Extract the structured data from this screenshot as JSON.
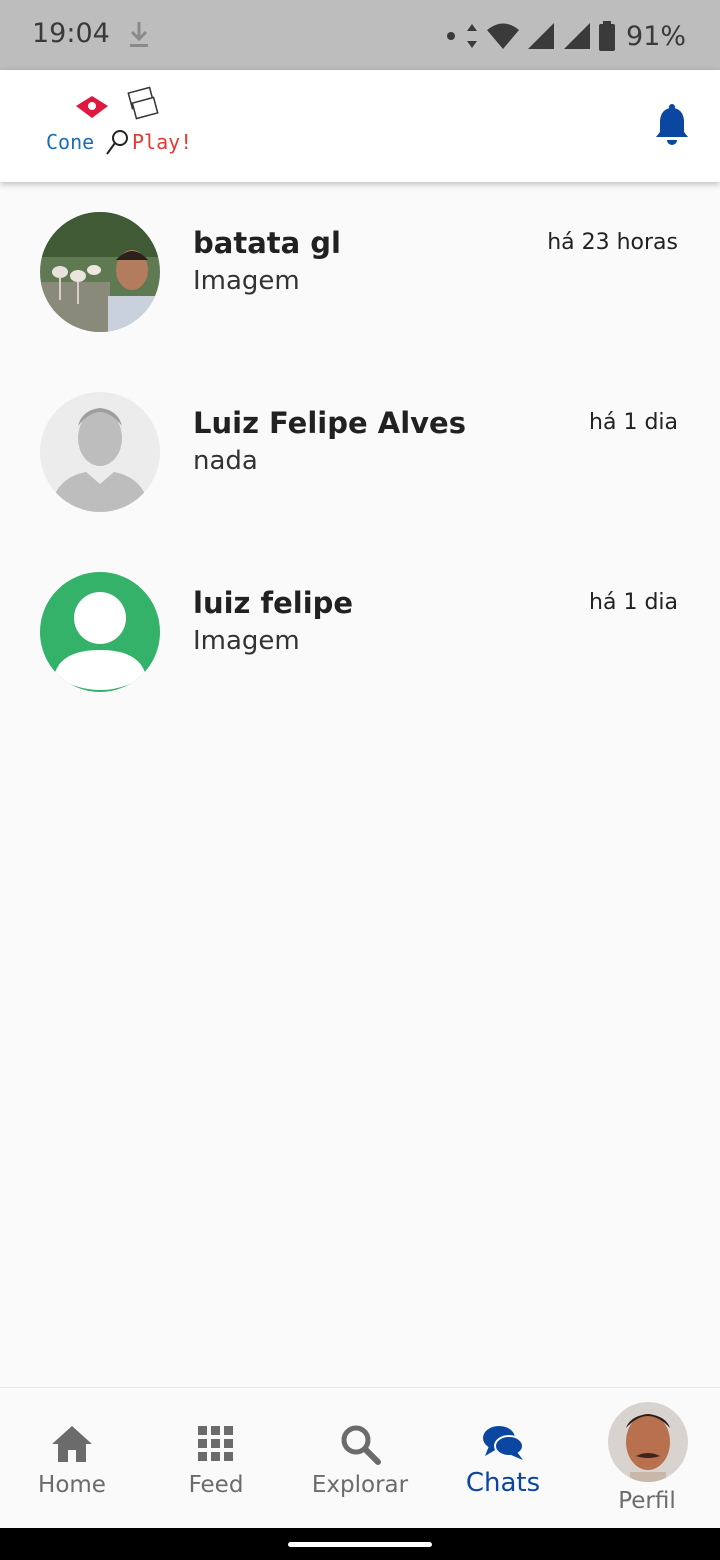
{
  "status_bar": {
    "time": "19:04",
    "battery": "91%",
    "icons": [
      "download-icon",
      "dot-icon",
      "data-arrows-icon",
      "wifi-icon",
      "signal-icon",
      "signal-icon",
      "battery-icon"
    ]
  },
  "header": {
    "logo_left": "Cone",
    "logo_right": "Play!",
    "notification_icon": "bell-icon",
    "accent": "#0b47a1"
  },
  "chats": [
    {
      "name": "batata gl",
      "preview": "Imagem",
      "time": "há 23 horas",
      "avatar": "photo-avatar"
    },
    {
      "name": "Luiz Felipe Alves",
      "preview": "nada",
      "time": "há 1 dia",
      "avatar": "placeholder-gray-avatar"
    },
    {
      "name": "luiz felipe",
      "preview": "Imagem",
      "time": "há 1 dia",
      "avatar": "placeholder-green-avatar"
    }
  ],
  "nav": {
    "items": [
      {
        "label": "Home",
        "icon": "home-icon"
      },
      {
        "label": "Feed",
        "icon": "grid-icon"
      },
      {
        "label": "Explorar",
        "icon": "search-icon"
      },
      {
        "label": "Chats",
        "icon": "chat-icon",
        "active": true
      },
      {
        "label": "Perfil",
        "icon": "profile-avatar"
      }
    ],
    "active_color": "#0b47a1",
    "inactive_color": "#6b6b6b"
  }
}
